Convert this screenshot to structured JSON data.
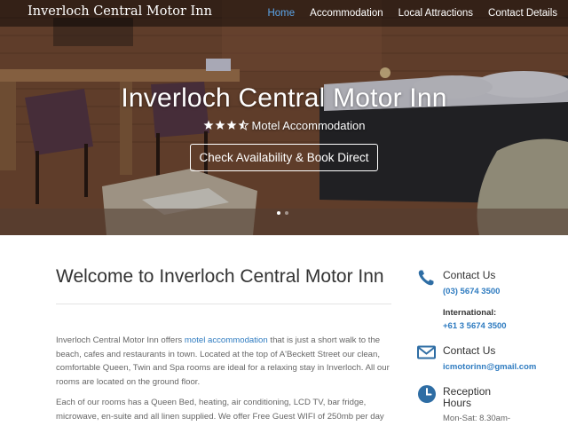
{
  "header": {
    "brand": "Inverloch Central Motor Inn",
    "nav": [
      {
        "label": "Home",
        "active": true
      },
      {
        "label": "Accommodation",
        "active": false
      },
      {
        "label": "Local Attractions",
        "active": false
      },
      {
        "label": "Contact Details",
        "active": false
      }
    ]
  },
  "hero": {
    "title": "Inverloch Central Motor Inn",
    "rating_stars": 3.5,
    "subtitle": "Motel Accommodation",
    "cta_label": "Check Availability & Book Direct",
    "slides": 2,
    "active_slide": 1
  },
  "main": {
    "title": "Welcome to Inverloch Central Motor Inn",
    "para1_before_link": "Inverloch Central Motor Inn offers ",
    "para1_link": "motel accommodation",
    "para1_after_link": " that is just a short walk to the beach, cafes and restaurants in town. Located at the top of A'Beckett Street our clean, comfortable Queen, Twin and Spa rooms are ideal for a relaxing stay in Inverloch. All our rooms are located on the ground floor.",
    "para2": "Each of our rooms has a Queen Bed, heating, air conditioning, LCD TV, bar fridge, microwave, en-suite and all linen supplied. We offer Free Guest WIFI of 250mb per day"
  },
  "sidebar": {
    "contact_phone_heading": "Contact Us",
    "phone": "(03) 5674 3500",
    "international_label": "International:",
    "international_phone": "+61 3 5674 3500",
    "contact_email_heading": "Contact Us",
    "email": "icmotorinn@gmail.com",
    "hours_heading_line1": "Reception",
    "hours_heading_line2": "Hours",
    "hours_text": "Mon-Sat: 8.30am-"
  },
  "colors": {
    "accent": "#2e7bc0",
    "nav_active": "#5ba4e8",
    "heading": "#333333",
    "body_text": "#666666"
  },
  "icons": {
    "phone": "phone-icon",
    "email": "email-icon",
    "clock": "clock-icon",
    "star": "star-icon"
  }
}
